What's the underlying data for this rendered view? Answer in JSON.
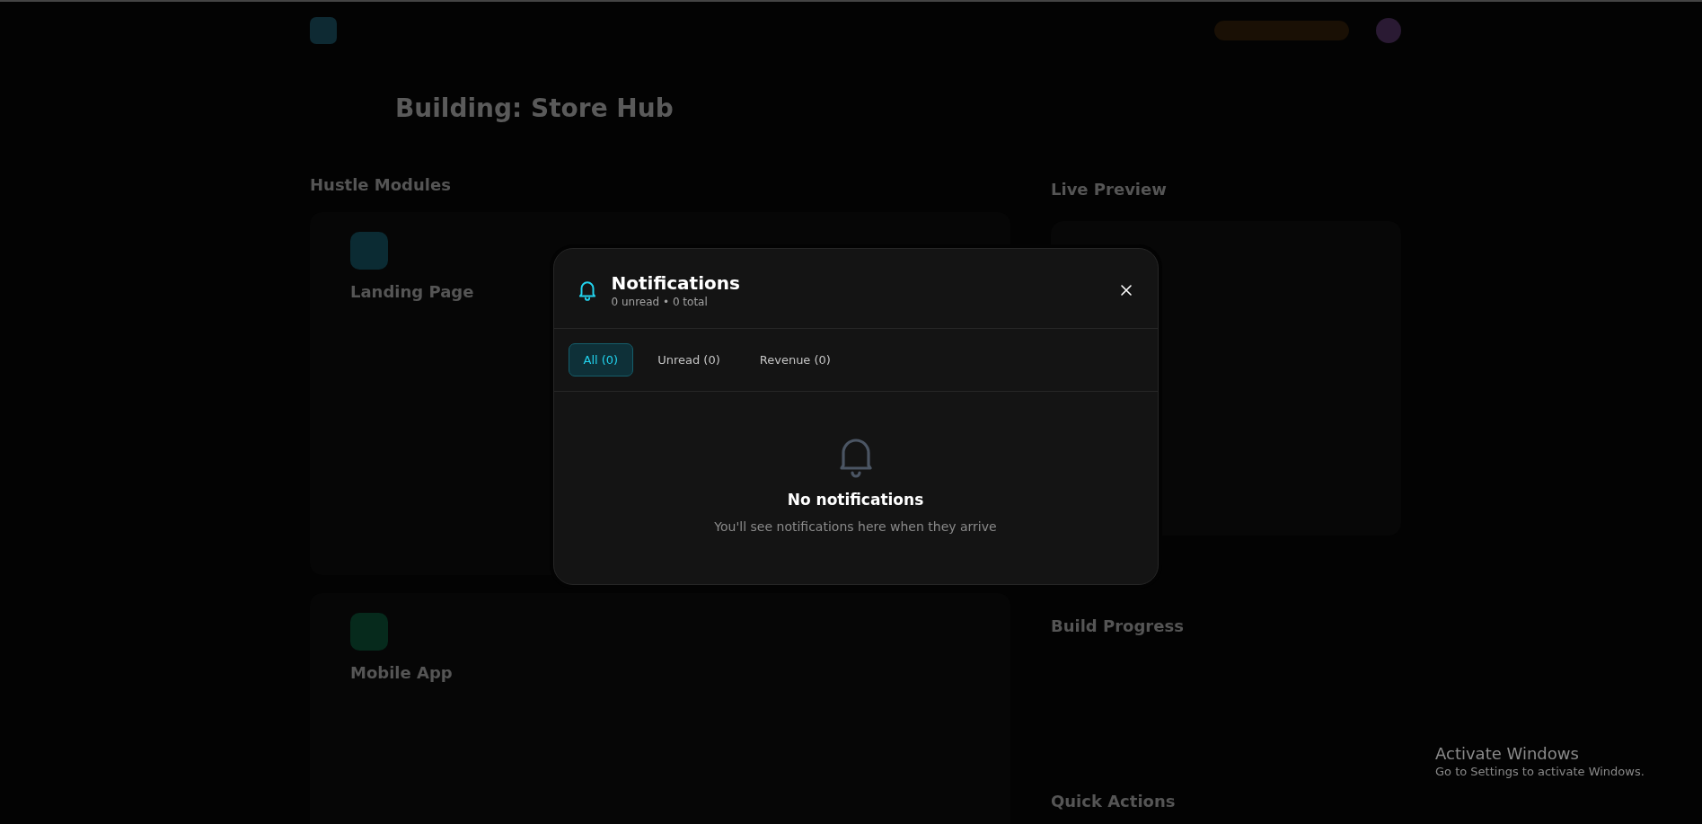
{
  "background": {
    "page_title": "Building: Store Hub",
    "left_heading": "Hustle Modules",
    "modules": [
      "Landing Page",
      "Mobile App"
    ],
    "right_headings": [
      "Live Preview",
      "Build Progress",
      "Quick Actions"
    ]
  },
  "dialog": {
    "title": "Notifications",
    "subtitle": "0 unread • 0 total",
    "tabs": [
      {
        "label": "All (0)",
        "selected": true
      },
      {
        "label": "Unread (0)",
        "selected": false
      },
      {
        "label": "Revenue (0)",
        "selected": false
      }
    ],
    "empty_title": "No notifications",
    "empty_text": "You'll see notifications here when they arrive"
  },
  "os_notice": {
    "title": "Activate Windows",
    "text": "Go to Settings to activate Windows."
  }
}
